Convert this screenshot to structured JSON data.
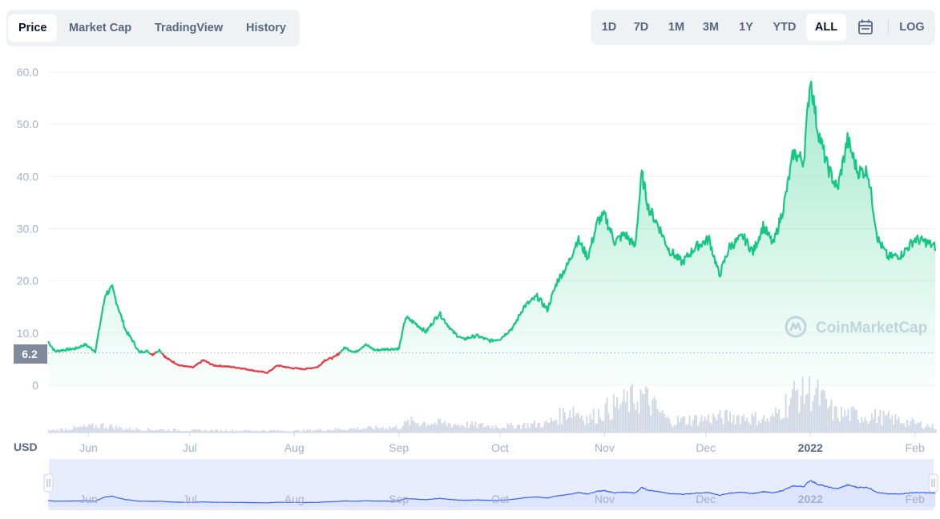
{
  "tabs": [
    {
      "label": "Price",
      "active": true
    },
    {
      "label": "Market Cap",
      "active": false
    },
    {
      "label": "TradingView",
      "active": false
    },
    {
      "label": "History",
      "active": false
    }
  ],
  "ranges": [
    {
      "label": "1D",
      "active": false
    },
    {
      "label": "7D",
      "active": false
    },
    {
      "label": "1M",
      "active": false
    },
    {
      "label": "3M",
      "active": false
    },
    {
      "label": "1Y",
      "active": false
    },
    {
      "label": "YTD",
      "active": false
    },
    {
      "label": "ALL",
      "active": true
    }
  ],
  "log_label": "LOG",
  "calendar_icon": "calendar-icon",
  "currency_label": "USD",
  "watermark": "CoinMarketCap",
  "colors": {
    "up": "#16c784",
    "down": "#ea3943",
    "grid": "#eff2f5",
    "axis_text": "#a6b0c3",
    "volume": "#cfd6e4",
    "navigator_line": "#3861fb",
    "navigator_fill": "#dce4fe"
  },
  "chart_data": {
    "type": "line",
    "title": "",
    "xlabel": "",
    "ylabel": "",
    "y_ticks": [
      "60.0",
      "50.0",
      "40.0",
      "30.0",
      "20.0",
      "10.0",
      "0"
    ],
    "ylim": [
      0,
      60
    ],
    "x_ticks": [
      "Jun",
      "Jul",
      "Aug",
      "Sep",
      "Oct",
      "Nov",
      "Dec",
      "2022",
      "Feb"
    ],
    "xlim": [
      "2021-05-20",
      "2022-02-07"
    ],
    "baseline": {
      "value": 6.2,
      "label": "6.2"
    },
    "grid": true,
    "series": [
      {
        "values_by_date": [
          [
            "2021-05-20",
            8.4
          ],
          [
            "2021-05-22",
            6.5
          ],
          [
            "2021-05-25",
            6.8
          ],
          [
            "2021-05-28",
            7.0
          ],
          [
            "2021-05-31",
            7.8
          ],
          [
            "2021-06-03",
            6.5
          ],
          [
            "2021-06-06",
            17.5
          ],
          [
            "2021-06-08",
            18.6
          ],
          [
            "2021-06-10",
            14.5
          ],
          [
            "2021-06-12",
            10.5
          ],
          [
            "2021-06-14",
            8.6
          ],
          [
            "2021-06-16",
            6.3
          ],
          [
            "2021-06-18",
            6.6
          ],
          [
            "2021-06-20",
            5.9
          ],
          [
            "2021-06-22",
            6.8
          ],
          [
            "2021-06-24",
            5.2
          ],
          [
            "2021-06-28",
            3.8
          ],
          [
            "2021-07-02",
            3.4
          ],
          [
            "2021-07-05",
            4.8
          ],
          [
            "2021-07-08",
            3.8
          ],
          [
            "2021-07-12",
            3.6
          ],
          [
            "2021-07-16",
            3.3
          ],
          [
            "2021-07-20",
            2.8
          ],
          [
            "2021-07-24",
            2.4
          ],
          [
            "2021-07-27",
            3.8
          ],
          [
            "2021-07-31",
            3.3
          ],
          [
            "2021-08-04",
            3.1
          ],
          [
            "2021-08-08",
            3.5
          ],
          [
            "2021-08-10",
            4.8
          ],
          [
            "2021-08-13",
            5.4
          ],
          [
            "2021-08-16",
            7.2
          ],
          [
            "2021-08-19",
            6.3
          ],
          [
            "2021-08-22",
            7.8
          ],
          [
            "2021-08-25",
            6.7
          ],
          [
            "2021-08-28",
            6.9
          ],
          [
            "2021-09-01",
            7.0
          ],
          [
            "2021-09-03",
            13.0
          ],
          [
            "2021-09-06",
            11.8
          ],
          [
            "2021-09-09",
            10.2
          ],
          [
            "2021-09-13",
            13.8
          ],
          [
            "2021-09-17",
            10.2
          ],
          [
            "2021-09-20",
            8.8
          ],
          [
            "2021-09-24",
            9.5
          ],
          [
            "2021-09-28",
            8.5
          ],
          [
            "2021-10-01",
            8.9
          ],
          [
            "2021-10-05",
            11.2
          ],
          [
            "2021-10-08",
            15.0
          ],
          [
            "2021-10-12",
            17.0
          ],
          [
            "2021-10-15",
            14.5
          ],
          [
            "2021-10-18",
            20.0
          ],
          [
            "2021-10-21",
            23.0
          ],
          [
            "2021-10-24",
            28.0
          ],
          [
            "2021-10-27",
            24.5
          ],
          [
            "2021-10-30",
            31.5
          ],
          [
            "2021-11-01",
            32.5
          ],
          [
            "2021-11-04",
            27.5
          ],
          [
            "2021-11-07",
            29.0
          ],
          [
            "2021-11-10",
            26.5
          ],
          [
            "2021-11-12",
            40.5
          ],
          [
            "2021-11-14",
            34.0
          ],
          [
            "2021-11-17",
            30.5
          ],
          [
            "2021-11-20",
            26.0
          ],
          [
            "2021-11-24",
            23.5
          ],
          [
            "2021-11-28",
            26.5
          ],
          [
            "2021-12-02",
            28.0
          ],
          [
            "2021-12-05",
            21.0
          ],
          [
            "2021-12-08",
            26.5
          ],
          [
            "2021-12-12",
            28.5
          ],
          [
            "2021-12-15",
            25.5
          ],
          [
            "2021-12-18",
            30.5
          ],
          [
            "2021-12-21",
            27.0
          ],
          [
            "2021-12-24",
            34.0
          ],
          [
            "2021-12-27",
            44.5
          ],
          [
            "2021-12-30",
            43.0
          ],
          [
            "2022-01-01",
            59.0
          ],
          [
            "2022-01-03",
            49.5
          ],
          [
            "2022-01-06",
            42.0
          ],
          [
            "2022-01-09",
            37.5
          ],
          [
            "2022-01-12",
            47.0
          ],
          [
            "2022-01-15",
            41.0
          ],
          [
            "2022-01-18",
            41.0
          ],
          [
            "2022-01-21",
            28.0
          ],
          [
            "2022-01-24",
            24.5
          ],
          [
            "2022-01-28",
            25.0
          ],
          [
            "2022-02-01",
            28.0
          ],
          [
            "2022-02-04",
            27.5
          ],
          [
            "2022-02-07",
            26.5
          ]
        ]
      }
    ],
    "volume": {
      "values_by_date": [
        [
          "2021-05-20",
          0.4
        ],
        [
          "2021-06-05",
          1.6
        ],
        [
          "2021-06-12",
          0.8
        ],
        [
          "2021-07-01",
          0.5
        ],
        [
          "2021-08-01",
          0.4
        ],
        [
          "2021-09-01",
          1.2
        ],
        [
          "2021-09-04",
          2.4
        ],
        [
          "2021-10-01",
          1.3
        ],
        [
          "2021-10-15",
          2.0
        ],
        [
          "2021-10-22",
          5.2
        ],
        [
          "2021-10-27",
          3.0
        ],
        [
          "2021-11-01",
          5.0
        ],
        [
          "2021-11-12",
          8.0
        ],
        [
          "2021-11-20",
          2.5
        ],
        [
          "2021-12-10",
          3.6
        ],
        [
          "2021-12-20",
          2.8
        ],
        [
          "2021-12-28",
          9.0
        ],
        [
          "2022-01-01",
          9.5
        ],
        [
          "2022-01-08",
          4.2
        ],
        [
          "2022-01-21",
          3.5
        ],
        [
          "2022-02-07",
          1.2
        ]
      ]
    }
  }
}
